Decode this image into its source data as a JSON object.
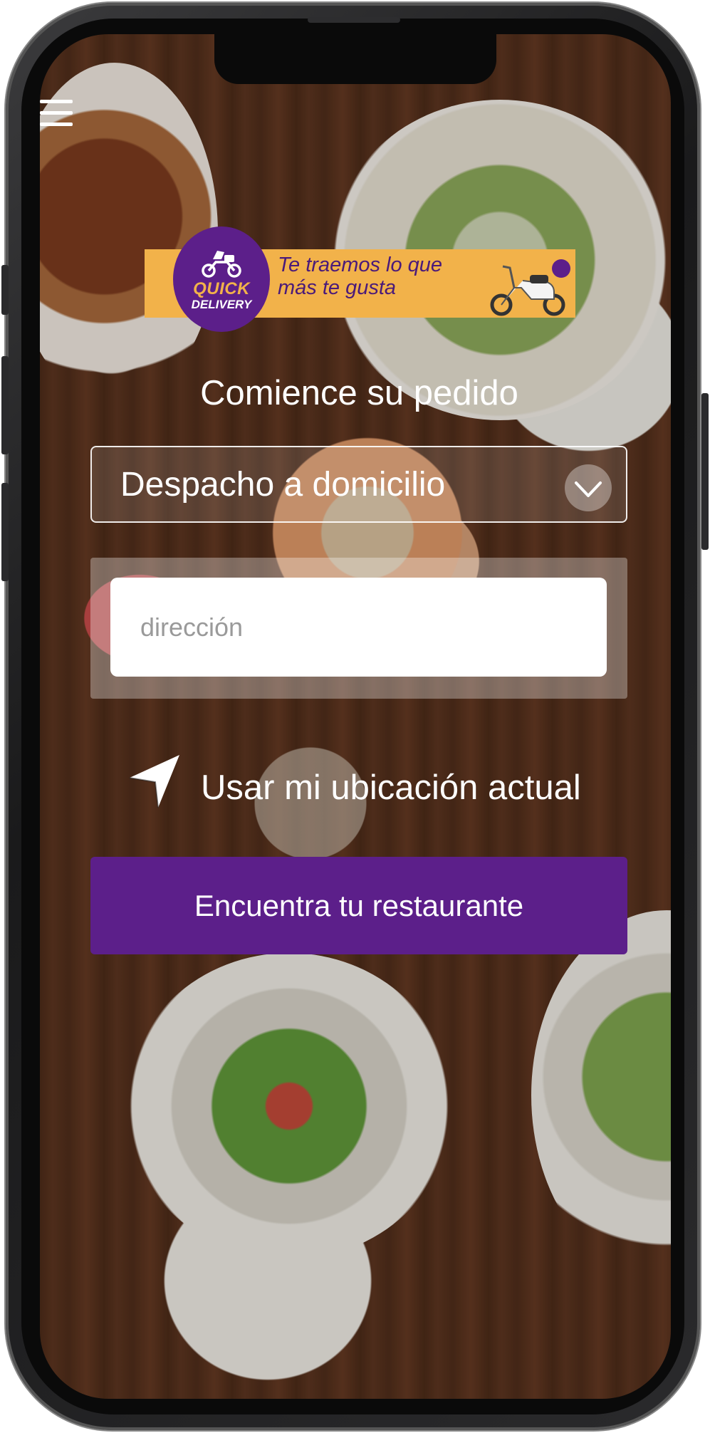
{
  "banner": {
    "logo_line1": "QUICK",
    "logo_line2": "DELIVERY",
    "tagline_line1": "Te traemos  lo que",
    "tagline_line2": "más te gusta"
  },
  "order": {
    "heading": "Comience su pedido",
    "delivery_mode": "Despacho a domicilio",
    "address_placeholder": "dirección",
    "use_location_label": "Usar mi ubicación actual",
    "find_button_label": "Encuentra tu restaurante"
  },
  "colors": {
    "brand_purple": "#5c1f8a",
    "brand_orange": "#f2b24a"
  },
  "icons": {
    "menu": "hamburger-menu-icon",
    "location": "navigation-arrow-icon",
    "dropdown": "chevron-down-icon",
    "logo_vehicle": "motorcycle-icon",
    "banner_vehicle": "scooter-illustration"
  }
}
